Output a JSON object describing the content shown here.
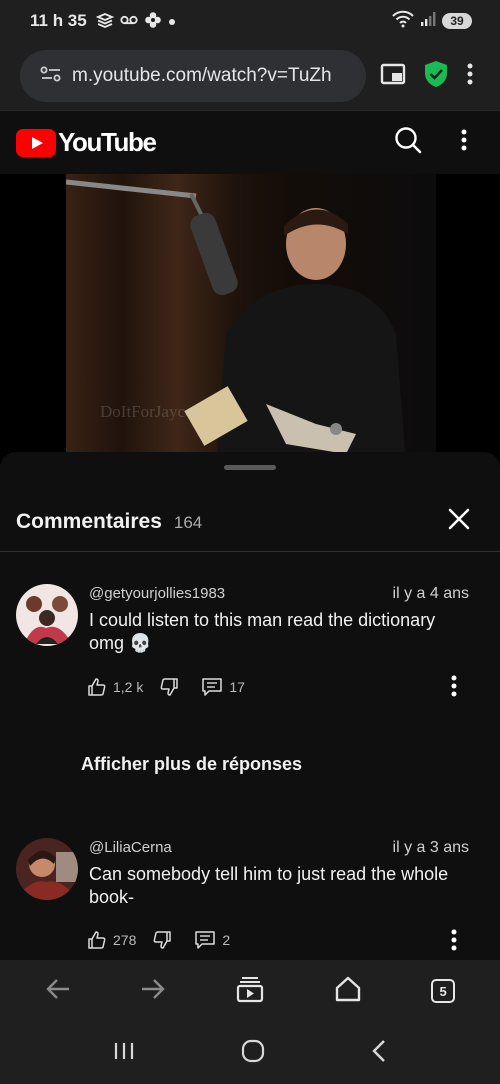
{
  "status": {
    "time": "11 h 35",
    "battery": "39"
  },
  "browser": {
    "url": "m.youtube.com/watch?v=TuZh",
    "tab_count": "5"
  },
  "youtube": {
    "logo_text": "YouTube"
  },
  "video": {
    "watermark": "DoItForJaycee"
  },
  "comments": {
    "title": "Commentaires",
    "count": "164",
    "items": [
      {
        "author": "@getyourjollies1983",
        "time": "il y a 4 ans",
        "text": "I could listen to this man read the dictionary omg 💀",
        "likes": "1,2 k",
        "replies": "17"
      },
      {
        "author": "@LiliaCerna",
        "time": "il y a 3 ans",
        "text": "Can somebody tell him to just read the whole book-",
        "likes": "278",
        "replies": "2"
      }
    ],
    "more_replies_label": "Afficher plus de réponses"
  },
  "colors": {
    "youtube_red": "#ff0000",
    "shield_green": "#1db954",
    "sheet_bg": "#0f0f0f",
    "chrome_bg": "#1f1f1f"
  }
}
